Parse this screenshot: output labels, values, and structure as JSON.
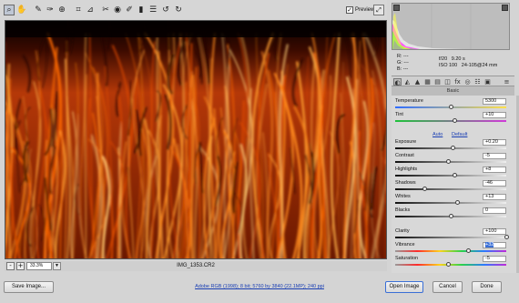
{
  "toolbar": {
    "tools": [
      "zoom-icon",
      "hand-icon",
      "white-balance-icon",
      "color-sampler-icon",
      "targeted-adjustment-icon",
      "crop-icon",
      "straighten-icon",
      "spot-removal-icon",
      "red-eye-icon",
      "adjustment-brush-icon",
      "graduated-filter-icon",
      "preferences-icon",
      "rotate-left-icon",
      "rotate-right-icon"
    ],
    "preview_label": "Preview"
  },
  "info": {
    "r_label": "R:",
    "g_label": "G:",
    "b_label": "B:",
    "r_value": "---",
    "g_value": "---",
    "b_value": "---",
    "aperture": "f/20",
    "shutter": "9.20 s",
    "iso": "ISO 100",
    "lens": "24-105@24 mm"
  },
  "panel": {
    "title": "Basic"
  },
  "sliders": [
    {
      "label": "Temperature",
      "value": "5300",
      "pos": 0.5,
      "track": "temp"
    },
    {
      "label": "Tint",
      "value": "+10",
      "pos": 0.54,
      "track": "tint"
    },
    {
      "label": "Exposure",
      "value": "+0.20",
      "pos": 0.52,
      "track": "gray"
    },
    {
      "label": "Contrast",
      "value": "-5",
      "pos": 0.48,
      "track": "gray"
    },
    {
      "label": "Highlights",
      "value": "+8",
      "pos": 0.54,
      "track": "gray"
    },
    {
      "label": "Shadows",
      "value": "-46",
      "pos": 0.27,
      "track": "gray"
    },
    {
      "label": "Whites",
      "value": "+13",
      "pos": 0.56,
      "track": "gray"
    },
    {
      "label": "Blacks",
      "value": "0",
      "pos": 0.5,
      "track": "gray"
    },
    {
      "label": "Clarity",
      "value": "+100",
      "pos": 1.0,
      "track": "gray"
    },
    {
      "label": "Vibrance",
      "value": "+32",
      "pos": 0.66,
      "track": "vib",
      "selected": true
    },
    {
      "label": "Saturation",
      "value": "-5",
      "pos": 0.48,
      "track": "vib"
    }
  ],
  "links": {
    "auto": "Auto",
    "default": "Default"
  },
  "zoom": {
    "minus": "-",
    "plus": "+",
    "value": "33.3%"
  },
  "filename": "IMG_1353.CR2",
  "footer": {
    "save_label": "Save Image...",
    "workflow": "Adobe RGB (1998); 8 bit; 5760 by 3840 (22.1MP); 240 ppi",
    "open_label": "Open Image",
    "cancel_label": "Cancel",
    "done_label": "Done"
  },
  "colors": {
    "accent": "#3a6fd6",
    "link": "#1a3fb3"
  }
}
